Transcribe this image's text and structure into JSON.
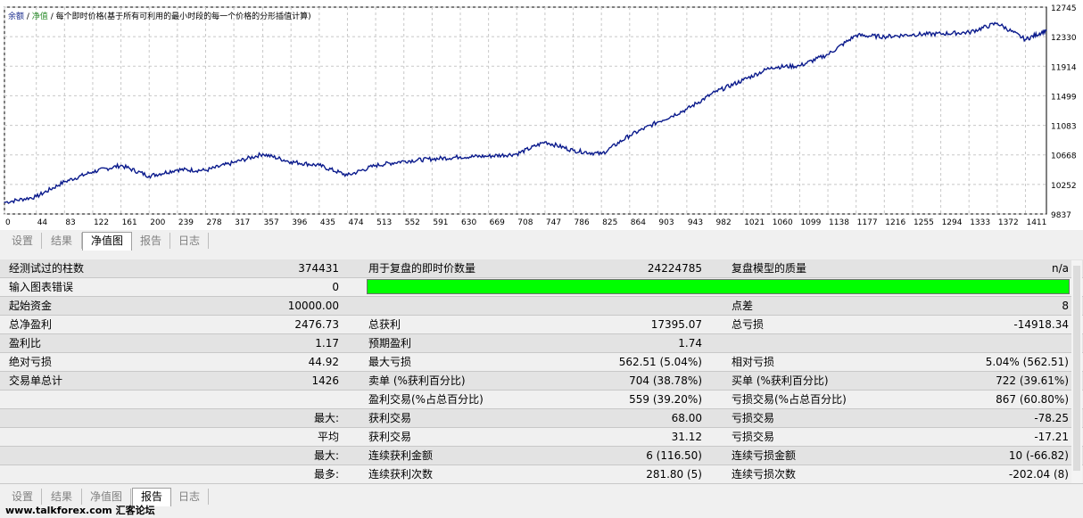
{
  "chart": {
    "legend_prefix": "余额",
    "legend_mid": "净值",
    "legend_text": "每个即时价格(基于所有可利用的最小时段的每一个价格的分形插值计算)",
    "y_ticks": [
      "12745",
      "12330",
      "11914",
      "11499",
      "11083",
      "10668",
      "10252",
      "9837"
    ],
    "x_ticks": [
      "0",
      "44",
      "83",
      "122",
      "161",
      "200",
      "239",
      "278",
      "317",
      "357",
      "396",
      "435",
      "474",
      "513",
      "552",
      "591",
      "630",
      "669",
      "708",
      "747",
      "786",
      "825",
      "864",
      "903",
      "943",
      "982",
      "1021",
      "1060",
      "1099",
      "1138",
      "1177",
      "1216",
      "1255",
      "1294",
      "1333",
      "1372",
      "1411"
    ],
    "line_color": "#0a1a8c"
  },
  "chart_data": {
    "type": "line",
    "ylim": [
      9837,
      12745
    ],
    "x": [
      0,
      44,
      83,
      122,
      161,
      200,
      239,
      278,
      317,
      357,
      396,
      435,
      474,
      513,
      552,
      591,
      630,
      669,
      708,
      747,
      786,
      825,
      864,
      903,
      943,
      982,
      1021,
      1060,
      1099,
      1138,
      1177,
      1216,
      1255,
      1294,
      1333,
      1372,
      1411,
      1440
    ],
    "y": [
      10000,
      10080,
      10290,
      10430,
      10520,
      10370,
      10460,
      10450,
      10560,
      10680,
      10570,
      10520,
      10380,
      10520,
      10580,
      10610,
      10640,
      10650,
      10680,
      10850,
      10730,
      10680,
      10940,
      11130,
      11310,
      11550,
      11720,
      11900,
      11920,
      12080,
      12350,
      12330,
      12360,
      12370,
      12390,
      12520,
      12290,
      12420
    ]
  },
  "tabs_top": [
    "设置",
    "结果",
    "净值图",
    "报告",
    "日志"
  ],
  "tabs_bottom": [
    "设置",
    "结果",
    "净值图",
    "报告",
    "日志"
  ],
  "report": {
    "rows": [
      {
        "l1": "经测试过的柱数",
        "v1": "374431",
        "l2": "用于复盘的即时价数量",
        "v2": "24224785",
        "l3": "复盘模型的质量",
        "v3": "n/a"
      },
      {
        "l1": "输入图表错误",
        "v1": "0",
        "l2": "",
        "v2": "",
        "l3": "",
        "v3": ""
      },
      {
        "l1": "起始资金",
        "v1": "10000.00",
        "l2": "",
        "v2": "",
        "l3": "点差",
        "v3": "8"
      },
      {
        "l1": "总净盈利",
        "v1": "2476.73",
        "l2": "总获利",
        "v2": "17395.07",
        "l3": "总亏损",
        "v3": "-14918.34"
      },
      {
        "l1": "盈利比",
        "v1": "1.17",
        "l2": "预期盈利",
        "v2": "1.74",
        "l3": "",
        "v3": ""
      },
      {
        "l1": "绝对亏损",
        "v1": "44.92",
        "l2": "最大亏损",
        "v2": "562.51 (5.04%)",
        "l3": "相对亏损",
        "v3": "5.04% (562.51)"
      },
      {
        "l1": "交易单总计",
        "v1": "1426",
        "l2": "卖单 (%获利百分比)",
        "v2": "704 (38.78%)",
        "l3": "买单 (%获利百分比)",
        "v3": "722 (39.61%)"
      },
      {
        "l1": "",
        "v1": "",
        "l2": "盈利交易(%占总百分比)",
        "v2": "559 (39.20%)",
        "l3": "亏损交易(%占总百分比)",
        "v3": "867 (60.80%)"
      },
      {
        "l1": "",
        "v1": "最大:",
        "l2": "获利交易",
        "v2": "68.00",
        "l3": "亏损交易",
        "v3": "-78.25"
      },
      {
        "l1": "",
        "v1": "平均",
        "l2": "获利交易",
        "v2": "31.12",
        "l3": "亏损交易",
        "v3": "-17.21"
      },
      {
        "l1": "",
        "v1": "最大:",
        "l2": "连续获利金额",
        "v2": "6 (116.50)",
        "l3": "连续亏损金额",
        "v3": "10 (-66.82)"
      },
      {
        "l1": "",
        "v1": "最多:",
        "l2": "连续获利次数",
        "v2": "281.80 (5)",
        "l3": "连续亏损次数",
        "v3": "-202.04 (8)"
      }
    ]
  },
  "watermark": "www.talkforex.com 汇客论坛"
}
